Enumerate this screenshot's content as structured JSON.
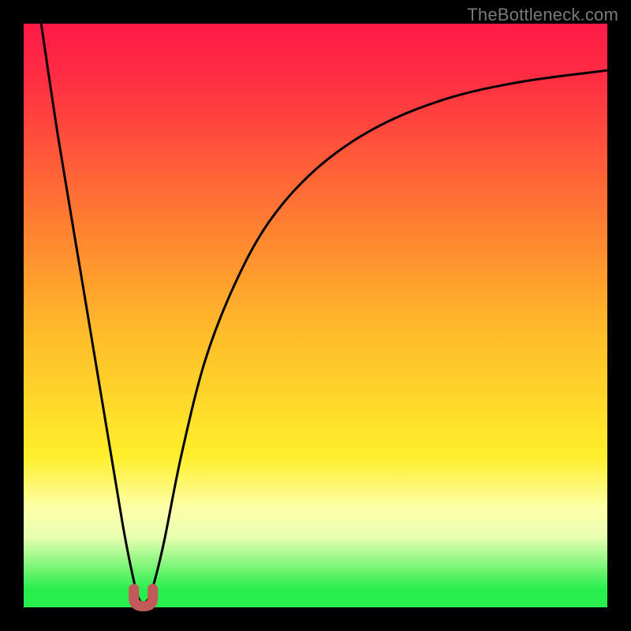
{
  "watermark": "TheBottleneck.com",
  "colors": {
    "red": "#ff1a47",
    "red2": "#ff2f42",
    "orange": "#ff8b2f",
    "orange_yellow": "#ffb92a",
    "yellow": "#ffee2a",
    "pale": "#fdffa8",
    "pale2": "#e7ffb0",
    "green": "#27ee4c",
    "curve": "#000000",
    "marker": "#c15a59"
  },
  "chart_data": {
    "type": "line",
    "title": "",
    "xlabel": "",
    "ylabel": "",
    "xlim": [
      0,
      100
    ],
    "ylim": [
      0,
      100
    ],
    "grid": false,
    "legend": false,
    "series": [
      {
        "name": "bottleneck-curve",
        "x": [
          3,
          6,
          10,
          14,
          17,
          19,
          20,
          21,
          22,
          24,
          27,
          31,
          36,
          42,
          50,
          60,
          72,
          85,
          100
        ],
        "y": [
          100,
          80,
          56,
          32,
          14,
          4,
          1,
          1,
          3,
          11,
          26,
          42,
          55,
          66,
          75,
          82,
          87,
          90,
          92
        ]
      }
    ],
    "background_gradient_stops": [
      {
        "pos": 0,
        "color": "#ff1a47"
      },
      {
        "pos": 10,
        "color": "#ff2f42"
      },
      {
        "pos": 38,
        "color": "#ff8b2f"
      },
      {
        "pos": 52,
        "color": "#ffb92a"
      },
      {
        "pos": 74,
        "color": "#ffee2a"
      },
      {
        "pos": 83,
        "color": "#fdffa8"
      },
      {
        "pos": 88,
        "color": "#e7ffb0"
      },
      {
        "pos": 97,
        "color": "#27ee4c"
      },
      {
        "pos": 100,
        "color": "#27ee4c"
      }
    ],
    "marker": {
      "x": 20.5,
      "y": 1,
      "shape": "u",
      "color": "#c15a59"
    }
  }
}
